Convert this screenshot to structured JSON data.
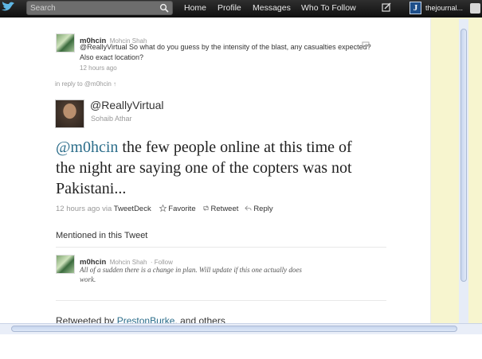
{
  "topbar": {
    "search_placeholder": "Search",
    "nav": [
      "Home",
      "Profile",
      "Messages",
      "Who To Follow"
    ],
    "account_initial": "J",
    "account_name": "thejournal..."
  },
  "tweet_reply": {
    "username": "m0hcin",
    "fullname": "Mohcin Shah",
    "text": "@ReallyVirtual So what do you guess by the intensity of the blast, any casualties expected? Also exact location?",
    "time": "12 hours ago"
  },
  "in_reply_to": "in reply to @m0hcin ↑",
  "main_tweet": {
    "username": "@ReallyVirtual",
    "fullname": "Sohaib Athar",
    "mention": "@m0hcin",
    "text": " the few people online at this time of the night are saying one of the copters was not Pakistani...",
    "time_via": "12 hours ago via",
    "client": "TweetDeck",
    "favorite": "Favorite",
    "retweet": "Retweet",
    "reply": "Reply"
  },
  "mentioned": {
    "heading": "Mentioned in this Tweet",
    "username": "m0hcin",
    "fullname": "Mohcin Shah",
    "follow": "· Follow",
    "bio": "All of a sudden there is a change in plan. Will update if this one actually does work."
  },
  "retweeted": {
    "prefix": "Retweeted by",
    "user": "PrestonBurke",
    "suffix": ", and others"
  },
  "colors": {
    "topbar": "#1a1a1a",
    "link": "#2b6d8a",
    "sidebar": "#f7f5cf"
  }
}
